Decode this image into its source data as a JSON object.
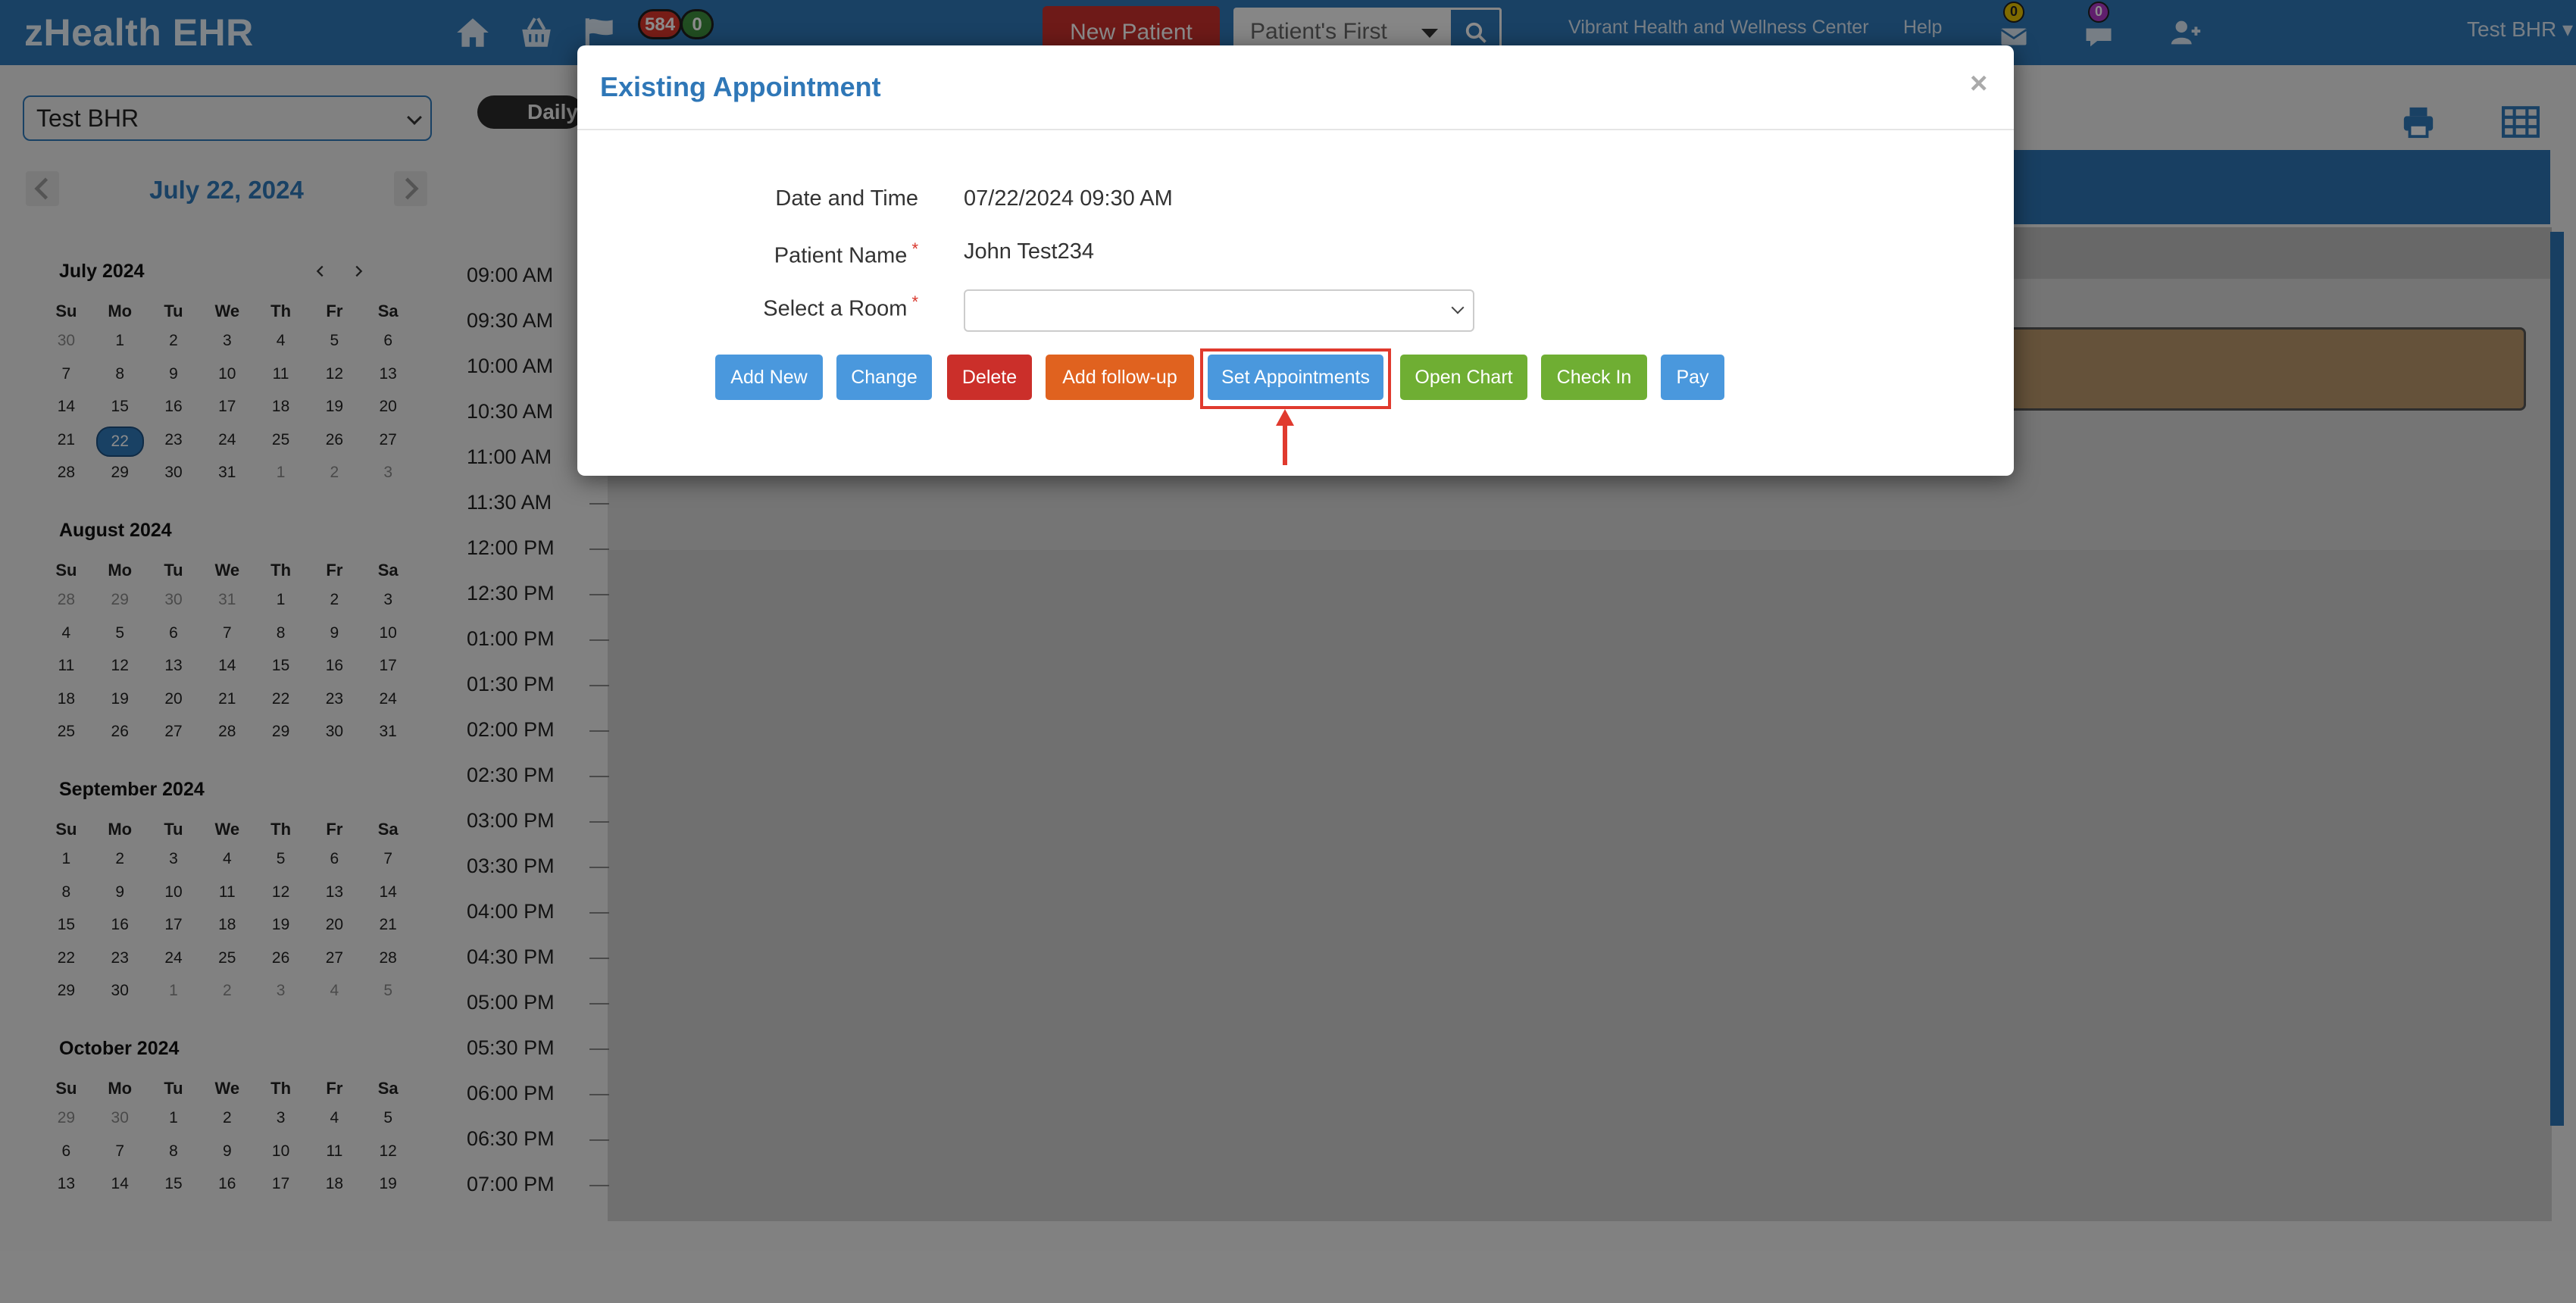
{
  "app": {
    "brand": "zHealth EHR"
  },
  "navbar": {
    "badges": {
      "flags_count": "584",
      "tasks_count": "0"
    },
    "new_patient_label": "New Patient",
    "search": {
      "mode_label": "Patient's First"
    },
    "clinic_name": "Vibrant Health and Wellness Center",
    "help_label": "Help",
    "messages_count": "0",
    "chat_count": "0",
    "user_label": "Test BHR"
  },
  "sidebar": {
    "provider_selected": "Test BHR",
    "current_date": "July 22, 2024",
    "calendars": [
      {
        "title": "July 2024",
        "weekdays": [
          "Su",
          "Mo",
          "Tu",
          "We",
          "Th",
          "Fr",
          "Sa"
        ],
        "weeks": [
          [
            "30",
            "1",
            "2",
            "3",
            "4",
            "5",
            "6"
          ],
          [
            "7",
            "8",
            "9",
            "10",
            "11",
            "12",
            "13"
          ],
          [
            "14",
            "15",
            "16",
            "17",
            "18",
            "19",
            "20"
          ],
          [
            "21",
            "22",
            "23",
            "24",
            "25",
            "26",
            "27"
          ],
          [
            "28",
            "29",
            "30",
            "31",
            "1",
            "2",
            "3"
          ]
        ]
      },
      {
        "title": "August 2024",
        "weekdays": [
          "Su",
          "Mo",
          "Tu",
          "We",
          "Th",
          "Fr",
          "Sa"
        ],
        "weeks": [
          [
            "28",
            "29",
            "30",
            "31",
            "1",
            "2",
            "3"
          ],
          [
            "4",
            "5",
            "6",
            "7",
            "8",
            "9",
            "10"
          ],
          [
            "11",
            "12",
            "13",
            "14",
            "15",
            "16",
            "17"
          ],
          [
            "18",
            "19",
            "20",
            "21",
            "22",
            "23",
            "24"
          ],
          [
            "25",
            "26",
            "27",
            "28",
            "29",
            "30",
            "31"
          ]
        ]
      },
      {
        "title": "September 2024",
        "weekdays": [
          "Su",
          "Mo",
          "Tu",
          "We",
          "Th",
          "Fr",
          "Sa"
        ],
        "weeks": [
          [
            "1",
            "2",
            "3",
            "4",
            "5",
            "6",
            "7"
          ],
          [
            "8",
            "9",
            "10",
            "11",
            "12",
            "13",
            "14"
          ],
          [
            "15",
            "16",
            "17",
            "18",
            "19",
            "20",
            "21"
          ],
          [
            "22",
            "23",
            "24",
            "25",
            "26",
            "27",
            "28"
          ],
          [
            "29",
            "30",
            "1",
            "2",
            "3",
            "4",
            "5"
          ]
        ]
      },
      {
        "title": "October 2024",
        "weekdays": [
          "Su",
          "Mo",
          "Tu",
          "We",
          "Th",
          "Fr",
          "Sa"
        ],
        "weeks": [
          [
            "29",
            "30",
            "1",
            "2",
            "3",
            "4",
            "5"
          ],
          [
            "6",
            "7",
            "8",
            "9",
            "10",
            "11",
            "12"
          ],
          [
            "13",
            "14",
            "15",
            "16",
            "17",
            "18",
            "19"
          ]
        ]
      }
    ]
  },
  "schedule": {
    "view_label": "Daily",
    "times": [
      "09:00 AM",
      "09:30 AM",
      "10:00 AM",
      "10:30 AM",
      "11:00 AM",
      "11:30 AM",
      "12:00 PM",
      "12:30 PM",
      "01:00 PM",
      "01:30 PM",
      "02:00 PM",
      "02:30 PM",
      "03:00 PM",
      "03:30 PM",
      "04:00 PM",
      "04:30 PM",
      "05:00 PM",
      "05:30 PM",
      "06:00 PM",
      "06:30 PM",
      "07:00 PM"
    ]
  },
  "modal": {
    "title": "Existing Appointment",
    "close_symbol": "×",
    "fields": {
      "datetime_label": "Date and Time",
      "datetime_value": "07/22/2024 09:30 AM",
      "patient_label": "Patient Name",
      "patient_value": "John Test234",
      "room_label": "Select a Room",
      "required_mark": "*"
    },
    "buttons": {
      "add_new": "Add New",
      "change": "Change",
      "delete": "Delete",
      "add_followup": "Add follow-up",
      "set_appointments": "Set Appointments",
      "open_chart": "Open Chart",
      "check_in": "Check In",
      "pay": "Pay"
    }
  },
  "colors": {
    "navbar": "#2f77b7",
    "btn_blue": "#4a98dd",
    "btn_red": "#cb2f2a",
    "btn_orange": "#e0621f",
    "btn_green": "#6fae33",
    "highlight": "#e03a2e"
  }
}
